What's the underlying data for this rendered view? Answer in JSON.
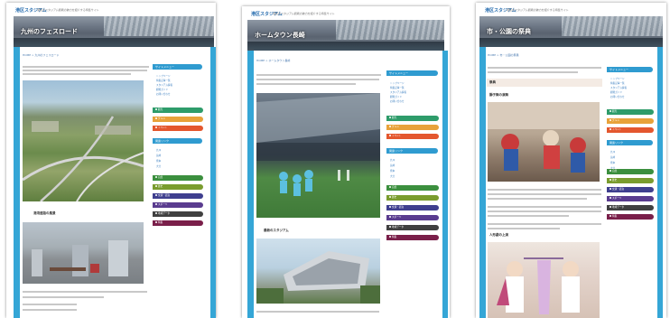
{
  "site": {
    "logo": "港区スタジアム",
    "tagline": "港区のスタジアム観戦の魅力を紹介する特集サイト"
  },
  "pages": [
    {
      "title": "九州のフェスロード",
      "breadcrumb": "HOME > 九州のフェスロード",
      "section_heading": "港湾道路の風景"
    },
    {
      "title": "ホームタウン長崎",
      "breadcrumb": "HOME > ホームタウン長崎",
      "section_heading": "最新のスタジアム"
    },
    {
      "title": "市・公園の祭典",
      "breadcrumb": "HOME > 市・公園の祭典",
      "section_heading": "祭典",
      "sub_heading": "獅子舞の演舞",
      "caption_heading": "人形劇の上演"
    }
  ],
  "sidebar": {
    "menu_head": "サイトメニュー",
    "links": [
      "トップページ",
      "特集記事一覧",
      "スタジアム情報",
      "観戦ガイド",
      "お問い合わせ"
    ],
    "sub_head": "関連リンク",
    "sub_links": [
      "九州",
      "長崎",
      "熊本",
      "大分",
      "宮崎"
    ],
    "categories": [
      {
        "label": "観光",
        "color": "#2e9c6a"
      },
      {
        "label": "グルメ",
        "color": "#e8a23a"
      },
      {
        "label": "イベント",
        "color": "#e4572e"
      },
      {
        "label": "自然",
        "color": "#3b8f3e"
      },
      {
        "label": "歴史",
        "color": "#7a9c2e"
      },
      {
        "label": "交通・宿泊",
        "color": "#3f3f8f"
      },
      {
        "label": "スポーツ",
        "color": "#5a3c8f"
      },
      {
        "label": "地域データ",
        "color": "#404040"
      },
      {
        "label": "特集",
        "color": "#7a1f4a"
      }
    ]
  }
}
